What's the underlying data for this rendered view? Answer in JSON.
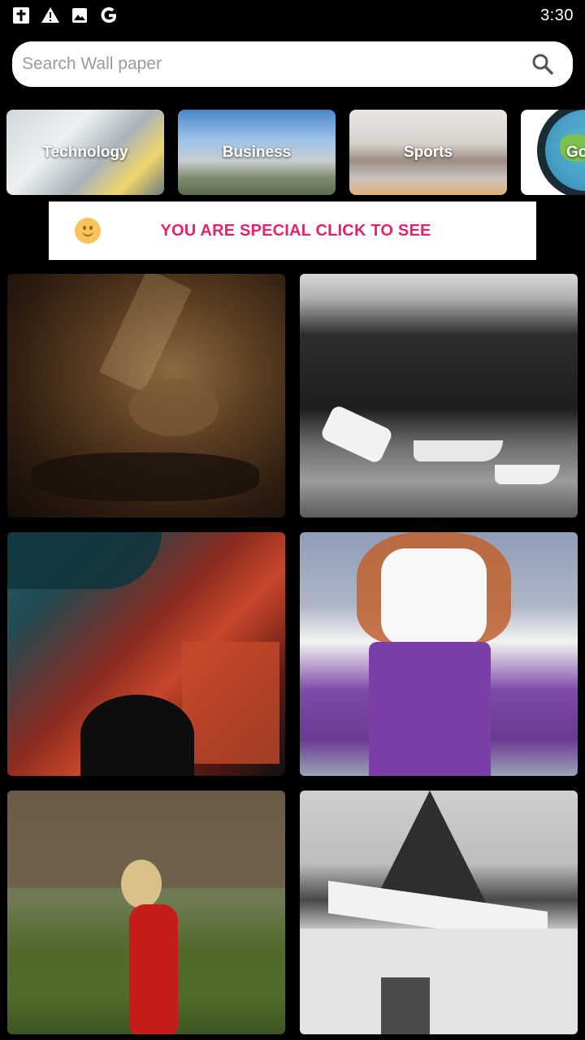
{
  "status_bar": {
    "time": "3:30",
    "icons": [
      "bible-app-icon",
      "warning-icon",
      "image-icon",
      "google-icon"
    ]
  },
  "search": {
    "placeholder": "Search Wall paper"
  },
  "categories": [
    {
      "label": "Technology"
    },
    {
      "label": "Business"
    },
    {
      "label": "Sports"
    },
    {
      "label": "Go"
    }
  ],
  "banner": {
    "text": "YOU ARE SPECIAL CLICK TO SEE",
    "icon": "smiley-icon"
  },
  "colors": {
    "background": "#000000",
    "banner_text": "#e0246e",
    "search_bg": "#ffffff"
  },
  "wallpapers": [
    {
      "subject": "woman-in-warm-light"
    },
    {
      "subject": "boats-on-shore-bw"
    },
    {
      "subject": "neon-street-night"
    },
    {
      "subject": "woman-purple-skirt"
    },
    {
      "subject": "woman-red-dress-field"
    },
    {
      "subject": "church-steeple-bw"
    }
  ]
}
